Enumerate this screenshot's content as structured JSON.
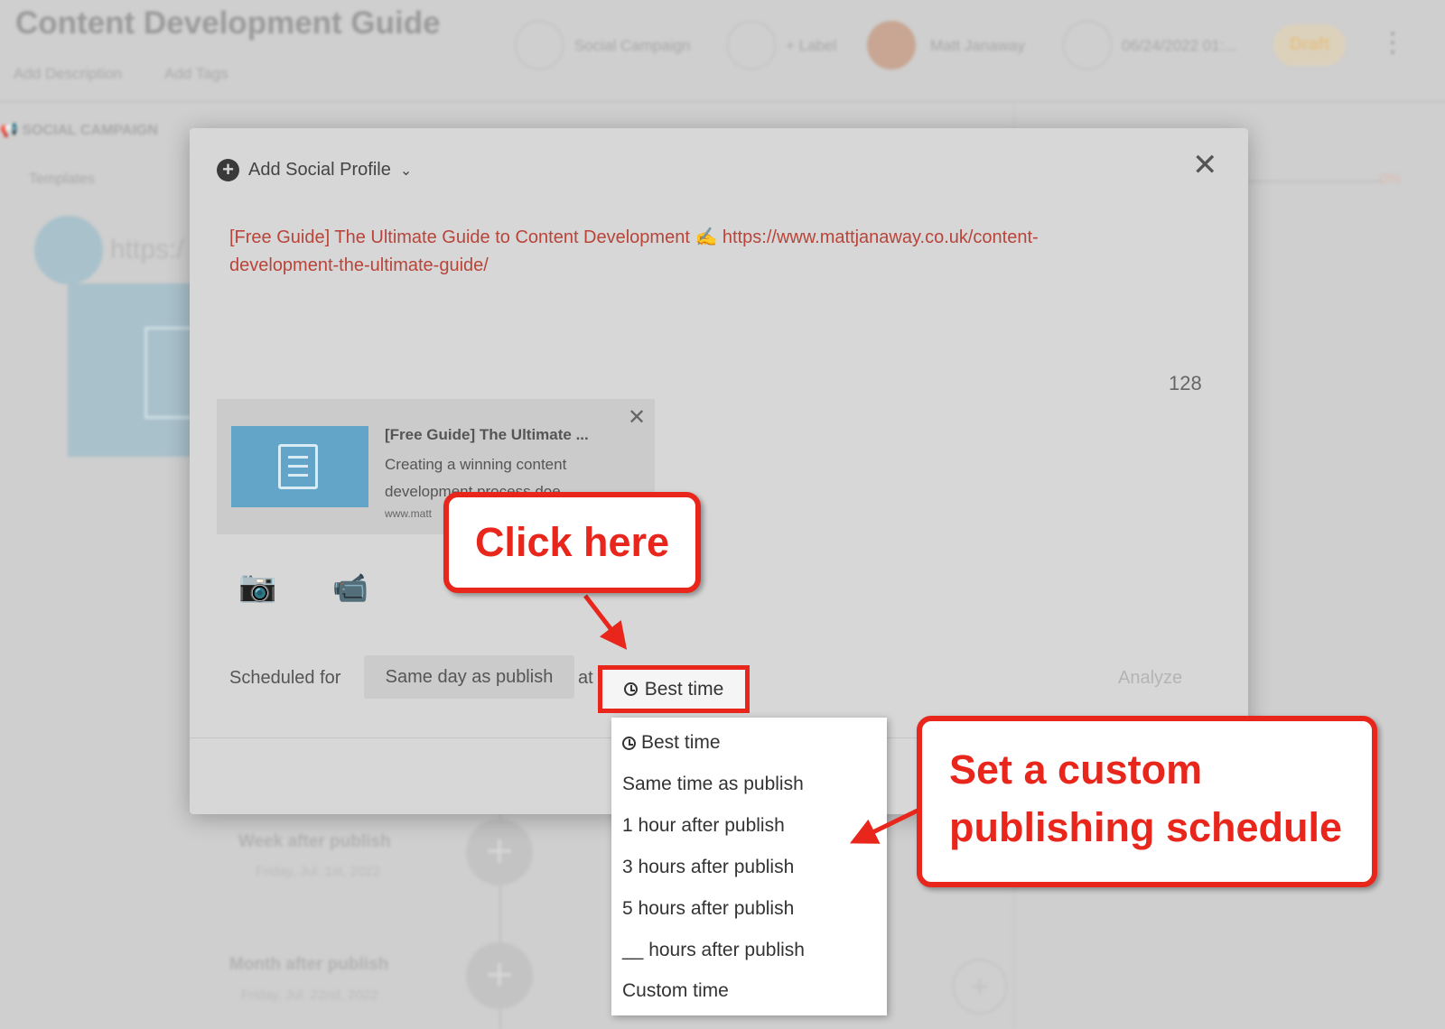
{
  "background": {
    "title": "Content Development Guide",
    "add_description": "Add Description",
    "add_tags": "Add Tags",
    "campaign_type": "Social Campaign",
    "label": "+ Label",
    "user": "Matt Janaway",
    "date": "06/24/2022 01:...",
    "status": "Draft",
    "section": "SOCIAL CAMPAIGN",
    "templates": "Templates",
    "link_placeholder": "https:/",
    "progress": "0%",
    "week_label": "Week after publish",
    "week_date": "Friday, Jul. 1st, 2022",
    "month_label": "Month after publish",
    "month_date": "Friday, Jul. 22nd, 2022"
  },
  "modal": {
    "add_profile": "Add Social Profile",
    "post_text": "[Free Guide] The Ultimate Guide to Content Development ✍ https://www.mattjanaway.co.uk/content-development-the-ultimate-guide/",
    "char_count": "128",
    "preview": {
      "title": "[Free Guide] The Ultimate ...",
      "description": "Creating a winning content development process doe...",
      "url": "www.matt"
    },
    "scheduled_label": "Scheduled for",
    "schedule_value": "Same day as publish",
    "at_label": "at",
    "time_value": "Best time",
    "analyze": "Analyze"
  },
  "dropdown": {
    "options": [
      "Best time",
      "Same time as publish",
      "1 hour after publish",
      "3 hours after publish",
      "5 hours after publish",
      "__ hours after publish",
      "Custom time"
    ]
  },
  "annotations": {
    "click_here": "Click here",
    "custom_schedule_line1": "Set a custom",
    "custom_schedule_line2": "publishing schedule"
  },
  "colors": {
    "annotation_red": "#e8261c",
    "post_text": "#b8443a",
    "preview_image": "#62a5c9"
  }
}
